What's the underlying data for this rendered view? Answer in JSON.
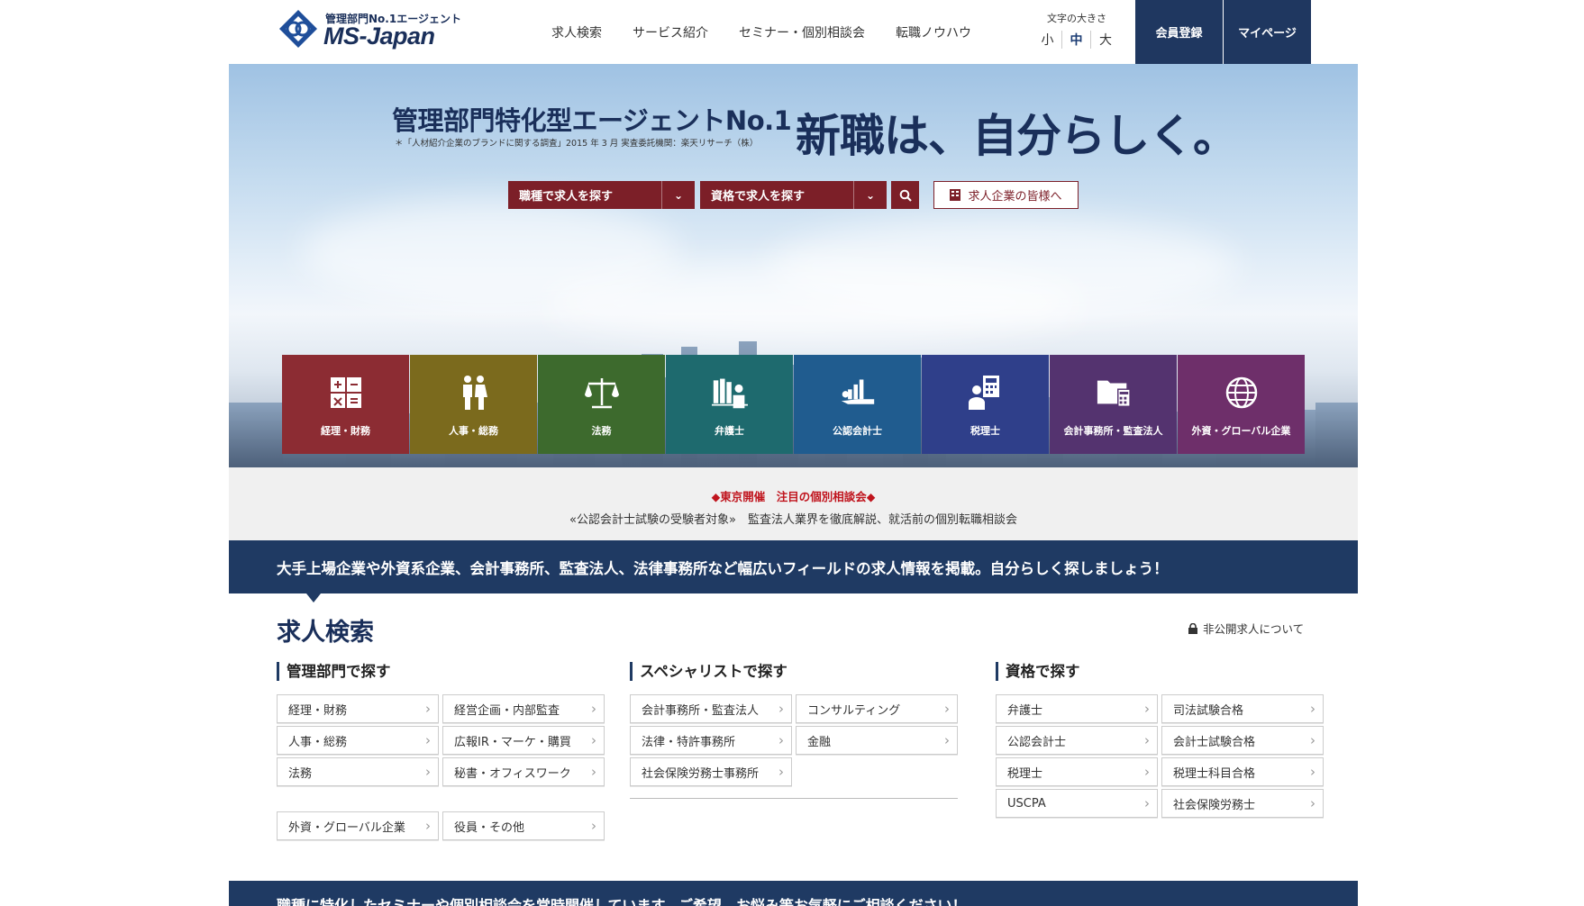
{
  "header": {
    "logo_sub": "管理部門No.1エージェント",
    "logo_main": "MS-Japan",
    "nav": [
      "求人検索",
      "サービス紹介",
      "セミナー・個別相談会",
      "転職ノウハウ"
    ],
    "font_size_label": "文字の大きさ",
    "font_sizes": [
      "小",
      "中",
      "大"
    ],
    "register": "会員登録",
    "mypage": "マイページ"
  },
  "hero": {
    "title1": "管理部門特化型エージェントNo.1",
    "note": "＊「人材紹介企業のブランドに関する調査」2015 年 3 月 実査委託機関：楽天リサーチ（株）",
    "title2": "新職は、自分らしく。",
    "select_job": "職種で求人を探す",
    "select_qual": "資格で求人を探す",
    "corp_link": "求人企業の皆様へ"
  },
  "tiles": [
    {
      "label": "経理・財務",
      "color": "#8c2c33",
      "icon": "calculator-icon"
    },
    {
      "label": "人事・総務",
      "color": "#7b6a1d",
      "icon": "people-icon"
    },
    {
      "label": "法務",
      "color": "#3d6a2d",
      "icon": "scales-icon"
    },
    {
      "label": "弁護士",
      "color": "#1e6a6e",
      "icon": "books-icon"
    },
    {
      "label": "公認会計士",
      "color": "#205c8f",
      "icon": "chart-icon"
    },
    {
      "label": "税理士",
      "color": "#2f3f8a",
      "icon": "calc-person-icon"
    },
    {
      "label": "会計事務所・監査法人",
      "color": "#54336f",
      "icon": "folder-icon"
    },
    {
      "label": "外資・グローバル企業",
      "color": "#6e2f6a",
      "icon": "globe-icon"
    }
  ],
  "notice": {
    "title": "◆東京開催　注目の個別相談会◆",
    "text": "«公認会計士試験の受験者対象»　監査法人業界を徹底解説、就活前の個別転職相談会"
  },
  "banner": "大手上場企業や外資系企業、会計事務所、監査法人、法律事務所など幅広いフィールドの求人情報を掲載。自分らしく探しましょう！",
  "search": {
    "title": "求人検索",
    "secret_link": "非公開求人について",
    "col1": {
      "heading": "管理部門で探す",
      "items": [
        "経理・財務",
        "経営企画・内部監査",
        "人事・総務",
        "広報IR・マーケ・購買",
        "法務",
        "秘書・オフィスワーク",
        "外資・グローバル企業",
        "役員・その他"
      ]
    },
    "col2": {
      "heading": "スペシャリストで探す",
      "items": [
        "会計事務所・監査法人",
        "コンサルティング",
        "法律・特許事務所",
        "金融",
        "社会保険労務士事務所"
      ]
    },
    "col3": {
      "heading": "資格で探す",
      "items": [
        "弁護士",
        "司法試験合格",
        "公認会計士",
        "会計士試験合格",
        "税理士",
        "税理士科目合格",
        "USCPA",
        "社会保険労務士"
      ]
    }
  },
  "bottom_banner": "職種に特化したセミナーや個別相談会を常時開催しています。ご希望、お悩み等お気軽にご相談ください！"
}
